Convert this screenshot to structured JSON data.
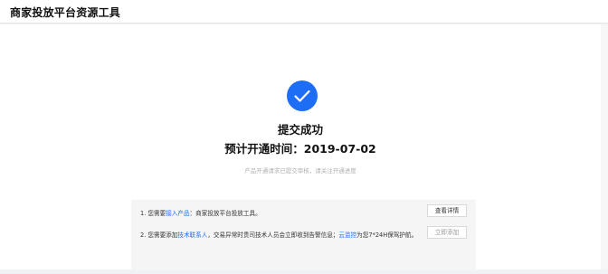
{
  "header": {
    "title": "商家投放平台资源工具"
  },
  "result": {
    "icon": "check-icon",
    "accent": "#1e6ef5",
    "title": "提交成功",
    "date_line": "预计开通时间：2019-07-02",
    "description": "产品开通请求已提交审核，请关注开通进度"
  },
  "notices": {
    "row1": {
      "prefix": "1. 您需要",
      "link": "接入产品",
      "suffix": "：商家投放平台投放工具。",
      "button": "查看详情"
    },
    "row2": {
      "prefix": "2. 您需要添加",
      "link1": "技术联系人",
      "middle": "，交易异常时贵司技术人员会立即收到告警信息；",
      "link2": "云监控",
      "suffix": "为您7*24H保驾护航。",
      "button": "立即添加"
    }
  }
}
